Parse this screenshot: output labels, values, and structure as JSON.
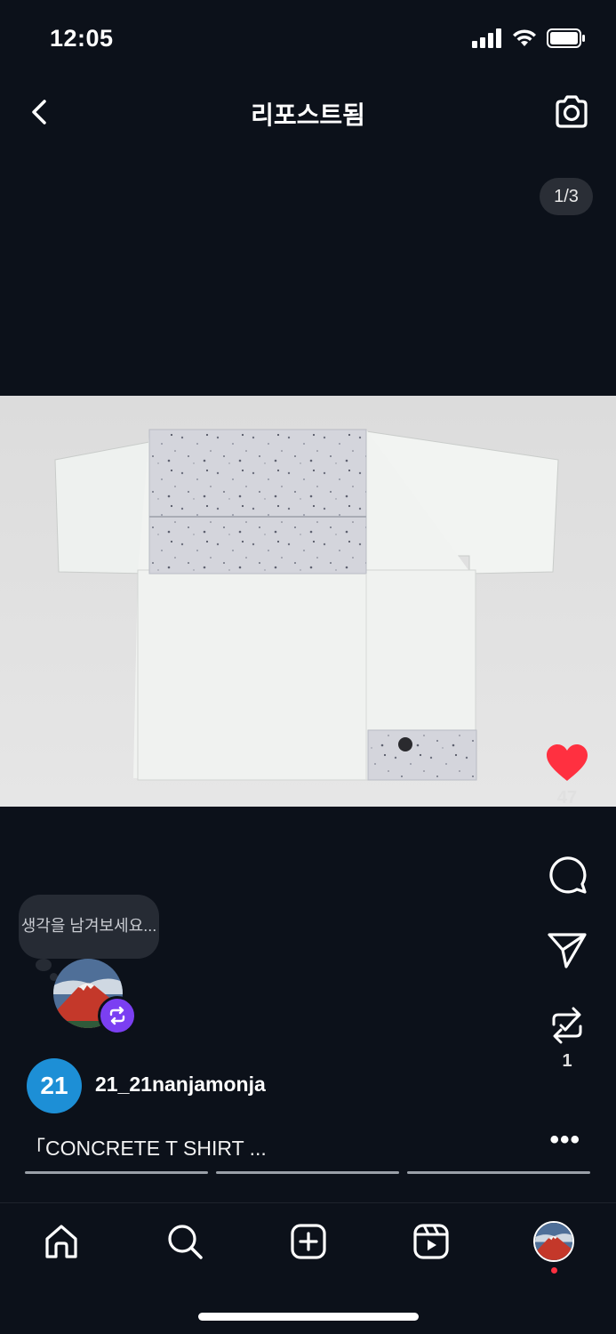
{
  "status_bar": {
    "time": "12:05"
  },
  "header": {
    "title": "리포스트됨"
  },
  "media": {
    "counter": "1/3"
  },
  "actions": {
    "like_count": "47",
    "repost_count": "1"
  },
  "thought_bubble": {
    "text": "생각을 남겨보세요..."
  },
  "post": {
    "avatar_text": "21",
    "username": "21_21nanjamonja",
    "caption": "「CONCRETE T SHIRT ...",
    "slide_count": 3
  },
  "colors": {
    "like": "#ff3040",
    "repost_badge": "#7b3ff2",
    "author_avatar": "#1d8fd6"
  },
  "icons": [
    "back-icon",
    "camera-icon",
    "heart-icon",
    "comment-icon",
    "share-icon",
    "repost-icon",
    "more-icon",
    "home-icon",
    "search-icon",
    "create-icon",
    "reels-icon"
  ]
}
